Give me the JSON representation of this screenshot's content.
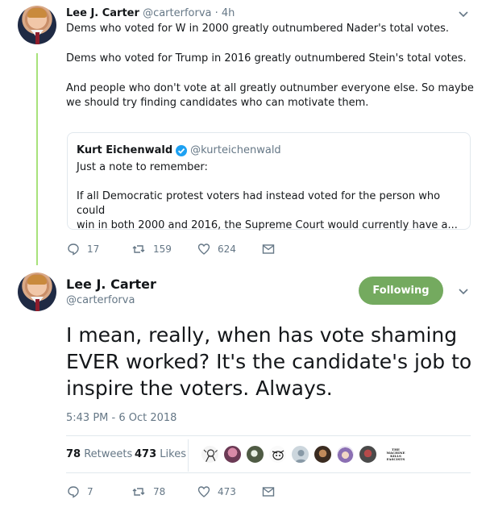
{
  "first_tweet": {
    "author_name": "Lee J. Carter",
    "author_handle": "@carterforva",
    "time": "· 4h",
    "para1": "Dems who voted for W in 2000 greatly outnumbered Nader's total votes.",
    "para2": "Dems who voted for Trump in 2016 greatly outnumbered Stein's total votes.",
    "para3_line1": "And people who don't vote at all greatly outnumber everyone else.  So maybe",
    "para3_line2": "we should try finding candidates who can motivate them.",
    "quote": {
      "author_name": "Kurt Eichenwald",
      "author_handle": "@kurteichenwald",
      "line1": "Just a note to remember:",
      "line2": "If all Democratic protest voters had instead voted for the person who could",
      "line3": "win in both 2000 and 2016, the Supreme Court would currently have a..."
    },
    "replies": "17",
    "retweets": "159",
    "likes": "624"
  },
  "main_tweet": {
    "author_name": "Lee J. Carter",
    "author_handle": "@carterforva",
    "follow_label": "Following",
    "text_line1": "I mean, really, when has vote shaming",
    "text_line2": "EVER worked?  It's the candidate's job to",
    "text_line3": "inspire the voters.  Always.",
    "timestamp": "5:43 PM - 6 Oct 2018",
    "retweet_count": "78",
    "retweet_label": "Retweets",
    "like_count": "473",
    "like_label": "Likes",
    "tiny_avatar_text": "THE MACHINE KILLS FASCISTS",
    "replies": "7",
    "retweets": "78",
    "likes": "473"
  },
  "colors": {
    "thread_line": "#a8e27b",
    "following_button": "#74aa5f",
    "verified": "#1da1f2",
    "muted": "#657786"
  }
}
